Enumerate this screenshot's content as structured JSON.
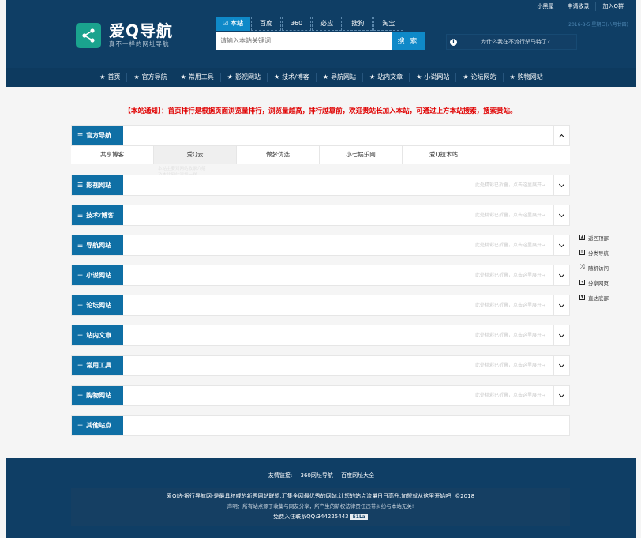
{
  "top_links": [
    "小黑屋",
    "申请收录",
    "加入Q群"
  ],
  "date_text": "2016-8-5 星期日(八月廿四)",
  "logo": {
    "title": "爱Q导航",
    "subtitle": "真不一样的网址导航"
  },
  "search": {
    "tabs": [
      "本站",
      "百度",
      "360",
      "必应",
      "搜狗",
      "淘宝"
    ],
    "placeholder": "请输入本站关键词",
    "button": "搜 索"
  },
  "notice_question": "为什么我在不流行杀马特了?",
  "nav": [
    "首页",
    "官方导航",
    "常用工具",
    "影视网站",
    "技术/博客",
    "导航网站",
    "站内文章",
    "小说网站",
    "论坛网站",
    "购物网站"
  ],
  "announcement": "【本站通知】：首页排行是根据页面浏览量排行，浏览量越高，排行越靠前，欢迎贵站长加入本站，可通过上方本站搜索，搜索贵站。",
  "sections": [
    {
      "label": "官方导航",
      "expanded": true
    },
    {
      "label": "影视网站",
      "collapsed_text": "此处精彩已折叠，点击这里展开→"
    },
    {
      "label": "技术/博客",
      "collapsed_text": "此处精彩已折叠，点击这里展开→"
    },
    {
      "label": "导航网站",
      "collapsed_text": "此处精彩已折叠，点击这里展开→"
    },
    {
      "label": "小说网站",
      "collapsed_text": "此处精彩已折叠，点击这里展开→"
    },
    {
      "label": "论坛网站",
      "collapsed_text": "此处精彩已折叠，点击这里展开→"
    },
    {
      "label": "站内文章",
      "collapsed_text": "此处精彩已折叠，点击这里展开→"
    },
    {
      "label": "常用工具",
      "collapsed_text": "此处精彩已折叠，点击这里展开→"
    },
    {
      "label": "购物网站",
      "collapsed_text": "此处精彩已折叠，点击这里展开→"
    },
    {
      "label": "其他站点"
    }
  ],
  "official_links": [
    "共享博客",
    "爱Q云",
    "做梦优选",
    "小七娱乐网",
    "爱Q技术站"
  ],
  "ghost_text": [
    "本站主要对网站收录介绍",
    "及本站网站添加一样"
  ],
  "side_menu": [
    {
      "label": "返回顶部",
      "icon": "arrow-up-icon"
    },
    {
      "label": "分类导航",
      "icon": "list-icon"
    },
    {
      "label": "随机访问",
      "icon": "shuffle-icon"
    },
    {
      "label": "分享网页",
      "icon": "share-icon"
    },
    {
      "label": "直达底部",
      "icon": "arrow-down-icon"
    }
  ],
  "footer": {
    "friends_label": "友情链接:",
    "friends": [
      "360网址导航",
      "百度网址大全"
    ],
    "line1": "爱Q站-银行导航网-是最具权威的新秀网站联盟,汇集全网最优秀的网站,让您的站点流量日日高升,加盟就从这里开始吧! ©2018",
    "line2": "声明：所有站点源于收集与网友分享，所产生的新权法律责任违带纠纷与本站无关!",
    "line3": "免费入住联系QQ:344225443",
    "badge": "51La"
  }
}
